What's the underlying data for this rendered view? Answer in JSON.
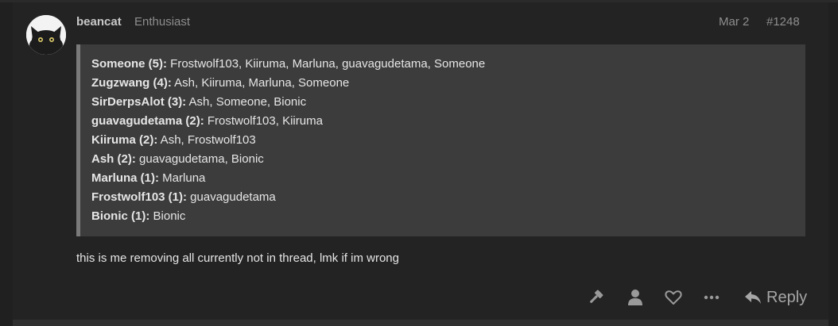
{
  "post": {
    "username": "beancat",
    "user_title": "Enthusiast",
    "date": "Mar 2",
    "post_number": "#1248",
    "quote_rows": [
      {
        "name": "Someone (5):",
        "voters": " Frostwolf103, Kiiruma, Marluna, guavagudetama, Someone"
      },
      {
        "name": "Zugzwang (4):",
        "voters": " Ash, Kiiruma, Marluna, Someone"
      },
      {
        "name": "SirDerpsAlot (3):",
        "voters": " Ash, Someone, Bionic"
      },
      {
        "name": "guavagudetama (2):",
        "voters": " Frostwolf103, Kiiruma"
      },
      {
        "name": "Kiiruma (2):",
        "voters": " Ash, Frostwolf103"
      },
      {
        "name": "Ash (2):",
        "voters": " guavagudetama, Bionic"
      },
      {
        "name": "Marluna (1):",
        "voters": " Marluna"
      },
      {
        "name": "Frostwolf103 (1):",
        "voters": " guavagudetama"
      },
      {
        "name": "Bionic (1):",
        "voters": " Bionic"
      }
    ],
    "body_text": "this is me removing all currently not in thread, lmk if im wrong"
  },
  "actions": {
    "reply_label": "Reply",
    "icons": [
      "gavel-icon",
      "user-icon",
      "heart-icon",
      "more-icon",
      "reply-icon"
    ]
  },
  "colors": {
    "background": "#202020",
    "post_background": "#232323",
    "quote_background": "#3c3c3c",
    "quote_border": "#7a7a7a",
    "muted_text": "#8e8e8e"
  }
}
